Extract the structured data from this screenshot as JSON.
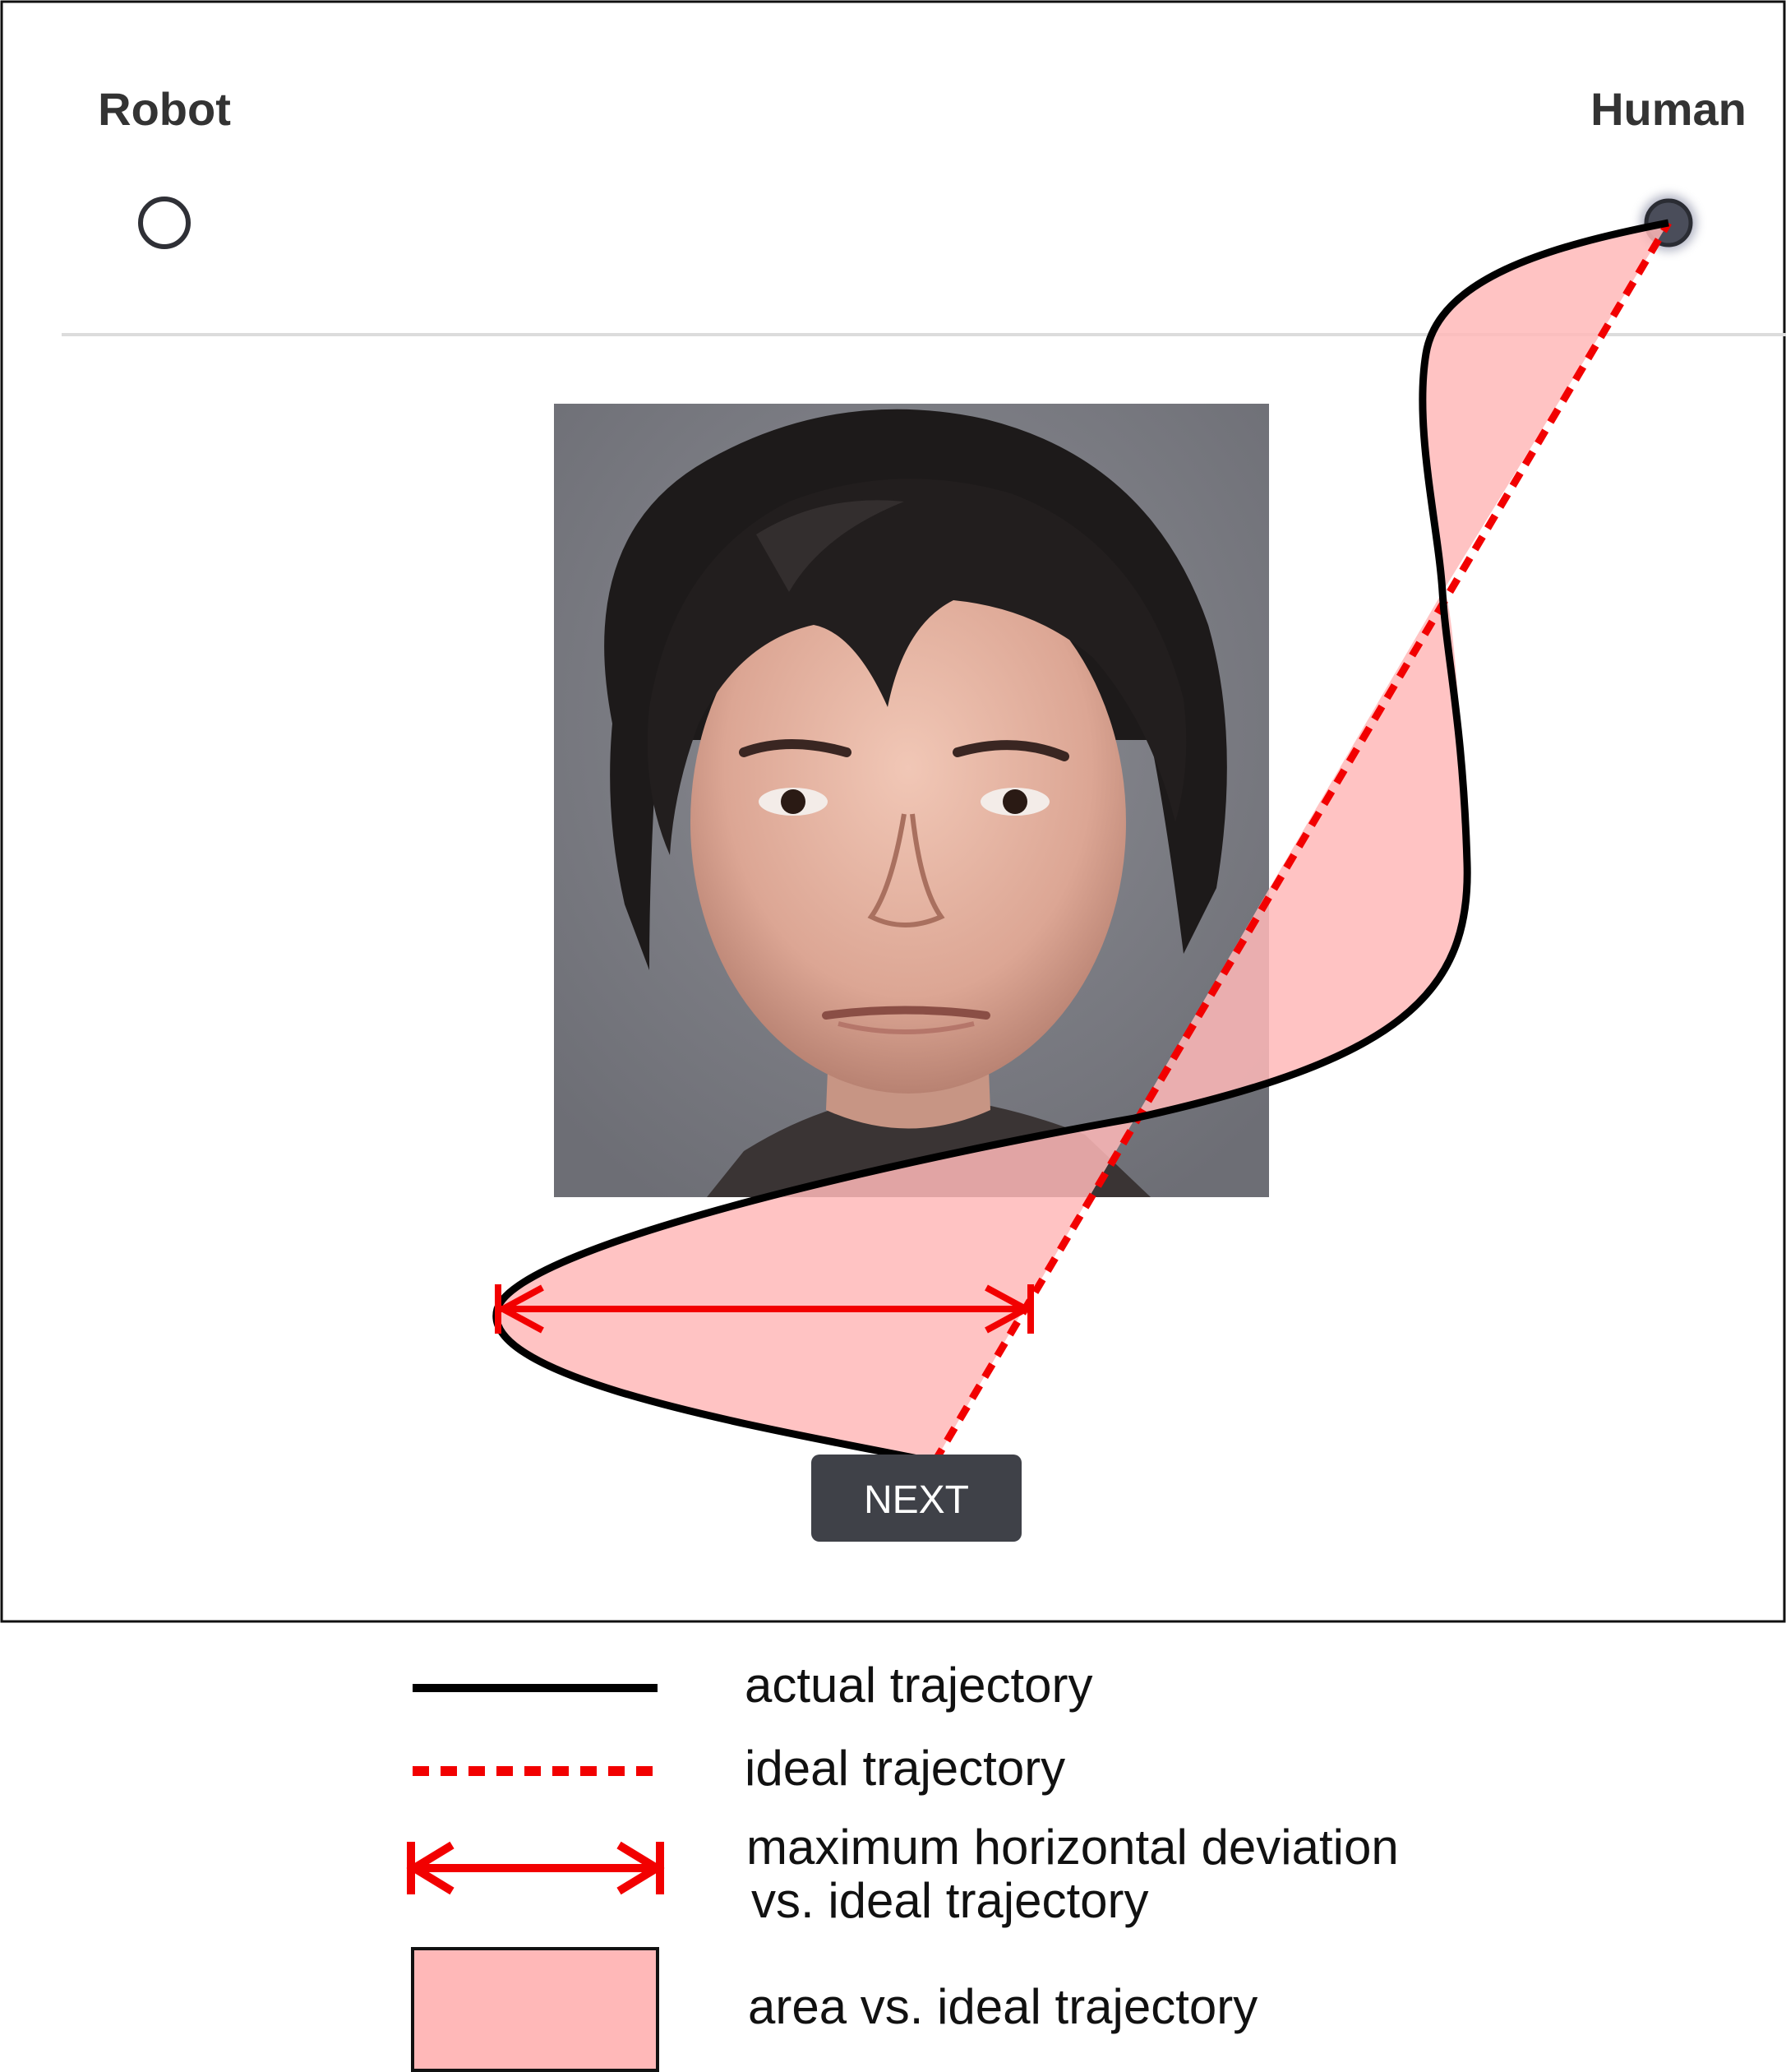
{
  "options": {
    "left_label": "Robot",
    "right_label": "Human"
  },
  "stimulus": {
    "description_icon": "face-photo"
  },
  "next_button": {
    "label": "NEXT"
  },
  "legend": {
    "actual": "actual trajectory",
    "ideal": "ideal trajectory",
    "deviation_line1": "maximum horizontal deviation",
    "deviation_line2": "vs. ideal trajectory",
    "area": "area vs. ideal trajectory"
  },
  "colors": {
    "actual": "#000000",
    "ideal": "#f20000",
    "area_fill": "#ffb8b8",
    "button_bg": "#3f4148",
    "selected_radio": "#4a4d5a"
  }
}
